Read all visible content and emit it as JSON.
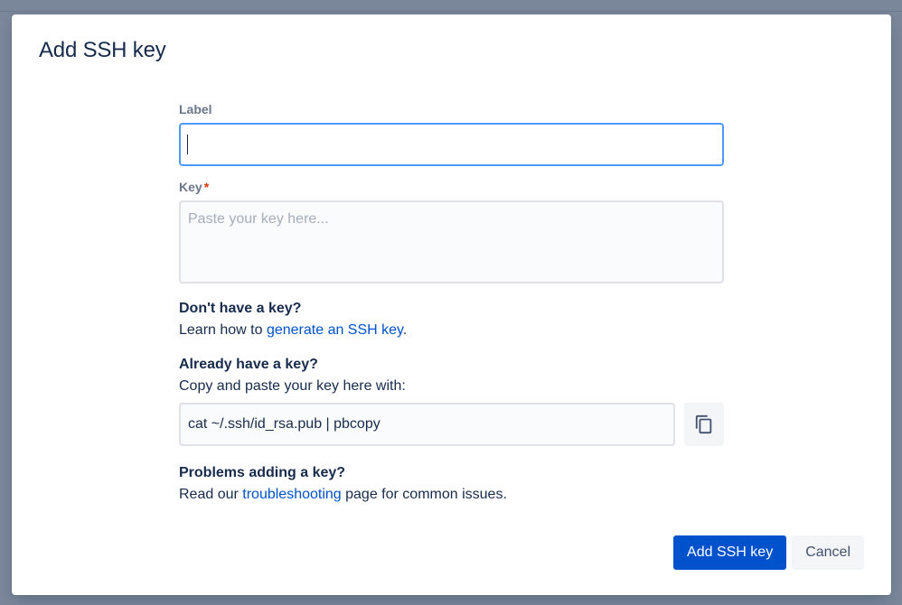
{
  "modal": {
    "title": "Add SSH key"
  },
  "form": {
    "label_field": {
      "label": "Label",
      "value": ""
    },
    "key_field": {
      "label": "Key",
      "required_marker": "*",
      "placeholder": "Paste your key here..."
    }
  },
  "help": {
    "no_key": {
      "heading": "Don't have a key?",
      "text_before": "Learn how to ",
      "link": "generate an SSH key",
      "text_after": "."
    },
    "have_key": {
      "heading": "Already have a key?",
      "text": "Copy and paste your key here with:",
      "command": "cat ~/.ssh/id_rsa.pub | pbcopy",
      "copy_icon": "copy-icon"
    },
    "problems": {
      "heading": "Problems adding a key?",
      "text_before": "Read our ",
      "link": "troubleshooting",
      "text_after": " page for common issues."
    }
  },
  "footer": {
    "primary_label": "Add SSH key",
    "cancel_label": "Cancel"
  },
  "colors": {
    "primary": "#0052cc",
    "focus_border": "#4c9aff",
    "required": "#de350b",
    "text": "#172b4d"
  }
}
